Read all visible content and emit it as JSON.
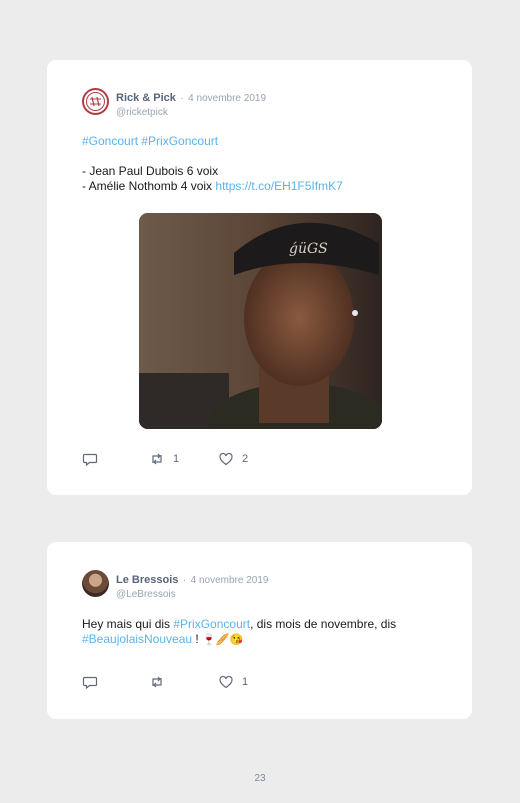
{
  "tweets": [
    {
      "display_name": "Rick & Pick",
      "date": "4 novembre 2019",
      "handle": "@ricketpick",
      "hashtags": "#Goncourt #PrixGoncourt",
      "line1": "- Jean Paul Dubois 6 voix",
      "line2_text": "- Amélie Nothomb 4 voix ",
      "line2_link": "https://t.co/EH1F5IfmK7",
      "retweets": "1",
      "likes": "2"
    },
    {
      "display_name": "Le Bressois",
      "date": "4 novembre 2019",
      "handle": "@LeBressois",
      "text_1": "Hey mais qui dis ",
      "link_1": "#PrixGoncourt",
      "text_2": ", dis mois de novembre, dis",
      "link_2": "#BeaujolaisNouveau",
      "text_3": " ! ",
      "emojis": "🍷🥖😘",
      "retweets": "",
      "likes": "1"
    }
  ],
  "separator": "·",
  "page_number": "23",
  "colors": {
    "background": "#ececec",
    "card": "#ffffff",
    "link": "#5bb3ea",
    "name": "#57647a",
    "meta": "#9aa4b1"
  },
  "icons": [
    "reply-icon",
    "retweet-icon",
    "heart-icon"
  ]
}
